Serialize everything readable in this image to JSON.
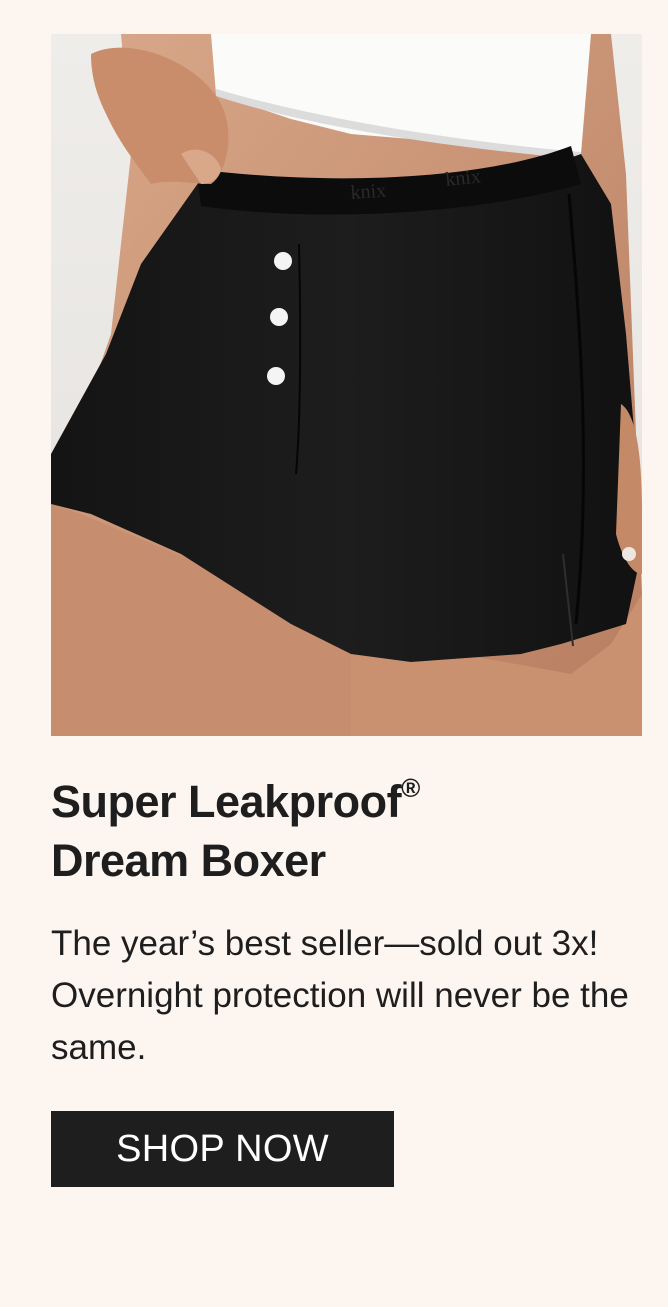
{
  "product": {
    "image_alt": "Woman wearing black Super Leakproof Dream Boxer shorts with white buttons",
    "waistband_text": "knix",
    "title_line1": "Super Leakproof",
    "title_mark": "®",
    "title_line2": "Dream Boxer",
    "description": "The year’s best seller—sold out 3x! Overnight protection will never be the same.",
    "cta_label": "SHOP NOW"
  },
  "colors": {
    "background": "#fcf5f0",
    "text": "#1f1e1e",
    "button_bg": "#1f1e1e",
    "button_text": "#ffffff"
  },
  "icons": {
    "product_photo": "boxer-shorts-photo"
  }
}
